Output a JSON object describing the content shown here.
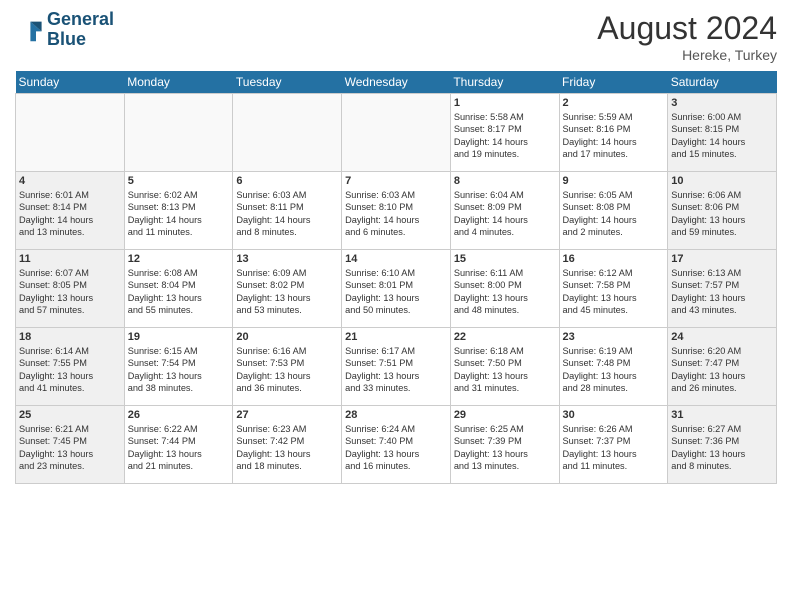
{
  "header": {
    "logo_line1": "General",
    "logo_line2": "Blue",
    "month_year": "August 2024",
    "location": "Hereke, Turkey"
  },
  "days_of_week": [
    "Sunday",
    "Monday",
    "Tuesday",
    "Wednesday",
    "Thursday",
    "Friday",
    "Saturday"
  ],
  "cells": [
    {
      "day": "",
      "info": "",
      "type": "empty"
    },
    {
      "day": "",
      "info": "",
      "type": "empty"
    },
    {
      "day": "",
      "info": "",
      "type": "empty"
    },
    {
      "day": "",
      "info": "",
      "type": "empty"
    },
    {
      "day": "1",
      "info": "Sunrise: 5:58 AM\nSunset: 8:17 PM\nDaylight: 14 hours\nand 19 minutes.",
      "type": "weekday"
    },
    {
      "day": "2",
      "info": "Sunrise: 5:59 AM\nSunset: 8:16 PM\nDaylight: 14 hours\nand 17 minutes.",
      "type": "weekday"
    },
    {
      "day": "3",
      "info": "Sunrise: 6:00 AM\nSunset: 8:15 PM\nDaylight: 14 hours\nand 15 minutes.",
      "type": "weekend"
    },
    {
      "day": "4",
      "info": "Sunrise: 6:01 AM\nSunset: 8:14 PM\nDaylight: 14 hours\nand 13 minutes.",
      "type": "weekend"
    },
    {
      "day": "5",
      "info": "Sunrise: 6:02 AM\nSunset: 8:13 PM\nDaylight: 14 hours\nand 11 minutes.",
      "type": "weekday"
    },
    {
      "day": "6",
      "info": "Sunrise: 6:03 AM\nSunset: 8:11 PM\nDaylight: 14 hours\nand 8 minutes.",
      "type": "weekday"
    },
    {
      "day": "7",
      "info": "Sunrise: 6:03 AM\nSunset: 8:10 PM\nDaylight: 14 hours\nand 6 minutes.",
      "type": "weekday"
    },
    {
      "day": "8",
      "info": "Sunrise: 6:04 AM\nSunset: 8:09 PM\nDaylight: 14 hours\nand 4 minutes.",
      "type": "weekday"
    },
    {
      "day": "9",
      "info": "Sunrise: 6:05 AM\nSunset: 8:08 PM\nDaylight: 14 hours\nand 2 minutes.",
      "type": "weekday"
    },
    {
      "day": "10",
      "info": "Sunrise: 6:06 AM\nSunset: 8:06 PM\nDaylight: 13 hours\nand 59 minutes.",
      "type": "weekend"
    },
    {
      "day": "11",
      "info": "Sunrise: 6:07 AM\nSunset: 8:05 PM\nDaylight: 13 hours\nand 57 minutes.",
      "type": "weekend"
    },
    {
      "day": "12",
      "info": "Sunrise: 6:08 AM\nSunset: 8:04 PM\nDaylight: 13 hours\nand 55 minutes.",
      "type": "weekday"
    },
    {
      "day": "13",
      "info": "Sunrise: 6:09 AM\nSunset: 8:02 PM\nDaylight: 13 hours\nand 53 minutes.",
      "type": "weekday"
    },
    {
      "day": "14",
      "info": "Sunrise: 6:10 AM\nSunset: 8:01 PM\nDaylight: 13 hours\nand 50 minutes.",
      "type": "weekday"
    },
    {
      "day": "15",
      "info": "Sunrise: 6:11 AM\nSunset: 8:00 PM\nDaylight: 13 hours\nand 48 minutes.",
      "type": "weekday"
    },
    {
      "day": "16",
      "info": "Sunrise: 6:12 AM\nSunset: 7:58 PM\nDaylight: 13 hours\nand 45 minutes.",
      "type": "weekday"
    },
    {
      "day": "17",
      "info": "Sunrise: 6:13 AM\nSunset: 7:57 PM\nDaylight: 13 hours\nand 43 minutes.",
      "type": "weekend"
    },
    {
      "day": "18",
      "info": "Sunrise: 6:14 AM\nSunset: 7:55 PM\nDaylight: 13 hours\nand 41 minutes.",
      "type": "weekend"
    },
    {
      "day": "19",
      "info": "Sunrise: 6:15 AM\nSunset: 7:54 PM\nDaylight: 13 hours\nand 38 minutes.",
      "type": "weekday"
    },
    {
      "day": "20",
      "info": "Sunrise: 6:16 AM\nSunset: 7:53 PM\nDaylight: 13 hours\nand 36 minutes.",
      "type": "weekday"
    },
    {
      "day": "21",
      "info": "Sunrise: 6:17 AM\nSunset: 7:51 PM\nDaylight: 13 hours\nand 33 minutes.",
      "type": "weekday"
    },
    {
      "day": "22",
      "info": "Sunrise: 6:18 AM\nSunset: 7:50 PM\nDaylight: 13 hours\nand 31 minutes.",
      "type": "weekday"
    },
    {
      "day": "23",
      "info": "Sunrise: 6:19 AM\nSunset: 7:48 PM\nDaylight: 13 hours\nand 28 minutes.",
      "type": "weekday"
    },
    {
      "day": "24",
      "info": "Sunrise: 6:20 AM\nSunset: 7:47 PM\nDaylight: 13 hours\nand 26 minutes.",
      "type": "weekend"
    },
    {
      "day": "25",
      "info": "Sunrise: 6:21 AM\nSunset: 7:45 PM\nDaylight: 13 hours\nand 23 minutes.",
      "type": "weekend"
    },
    {
      "day": "26",
      "info": "Sunrise: 6:22 AM\nSunset: 7:44 PM\nDaylight: 13 hours\nand 21 minutes.",
      "type": "weekday"
    },
    {
      "day": "27",
      "info": "Sunrise: 6:23 AM\nSunset: 7:42 PM\nDaylight: 13 hours\nand 18 minutes.",
      "type": "weekday"
    },
    {
      "day": "28",
      "info": "Sunrise: 6:24 AM\nSunset: 7:40 PM\nDaylight: 13 hours\nand 16 minutes.",
      "type": "weekday"
    },
    {
      "day": "29",
      "info": "Sunrise: 6:25 AM\nSunset: 7:39 PM\nDaylight: 13 hours\nand 13 minutes.",
      "type": "weekday"
    },
    {
      "day": "30",
      "info": "Sunrise: 6:26 AM\nSunset: 7:37 PM\nDaylight: 13 hours\nand 11 minutes.",
      "type": "weekday"
    },
    {
      "day": "31",
      "info": "Sunrise: 6:27 AM\nSunset: 7:36 PM\nDaylight: 13 hours\nand 8 minutes.",
      "type": "weekend"
    }
  ]
}
